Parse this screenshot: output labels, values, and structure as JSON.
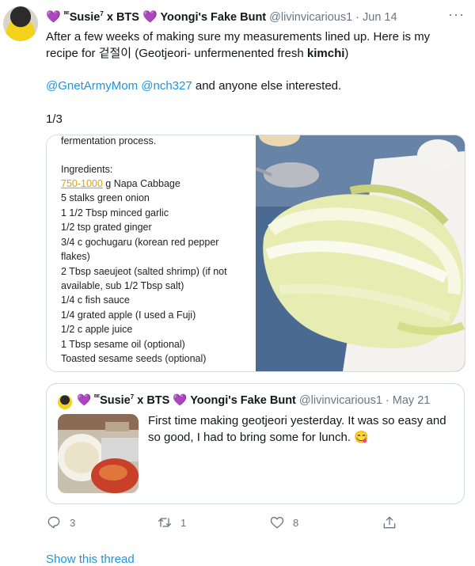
{
  "tweet": {
    "heart_left": "💜",
    "name_prefix": "ᴮᴱ",
    "name_main": "Susie",
    "name_sup": "7",
    "name_rest": " x BTS ",
    "heart_mid": "💜",
    "name_end": " Yoongi's Fake Bunt",
    "handle": "@livinvicarious1",
    "date": "· Jun 14",
    "more": "···",
    "text_line1": "After a few weeks of making sure my measurements lined up. Here is my",
    "text_line2_a": "recipe for 겉절이 (Geotjeori- unfermenented fresh ",
    "text_line2_b": "kimchi",
    "text_line2_c": ")",
    "mention1": "@GnetArmyMom",
    "mention2": "@nch327",
    "mention_rest": " and anyone else interested.",
    "counter": "1/3"
  },
  "recipe_card": {
    "intro": "fermentation process.",
    "heading": "Ingredients:",
    "first_amount": "750-1000",
    "first_rest": " g Napa Cabbage",
    "lines": [
      "5 stalks green onion",
      "1 1/2 Tbsp minced garlic",
      "1/2 tsp grated ginger",
      "3/4 c gochugaru (korean red pepper",
      "flakes)",
      "2 Tbsp saeujeot (salted shrimp) (if not",
      "available, sub 1/2 Tbsp salt)",
      "1/4 c fish sauce",
      "1/4 grated apple (I used a Fuji)",
      "1/2 c apple juice",
      "1 Tbsp sesame oil (optional)",
      "Toasted sesame seeds (optional)"
    ]
  },
  "quoted": {
    "heart_left": "💜",
    "name_prefix": "ᴮᴱ",
    "name_main": "Susie",
    "name_sup": "7",
    "name_rest": " x BTS ",
    "heart_mid": "💜",
    "name_end": " Yoongi's Fake Bunt",
    "handle": "@livinvicarious1",
    "date": "· May 21",
    "text": "First time making geotjeori yesterday. It was so easy and so good, I had to bring some for lunch. 😋"
  },
  "actions": {
    "replies": "3",
    "retweets": "1",
    "likes": "8"
  },
  "show_thread": "Show this thread",
  "colors": {
    "link": "#1b95e0",
    "muted": "#657786",
    "heart": "#9b59d0"
  }
}
